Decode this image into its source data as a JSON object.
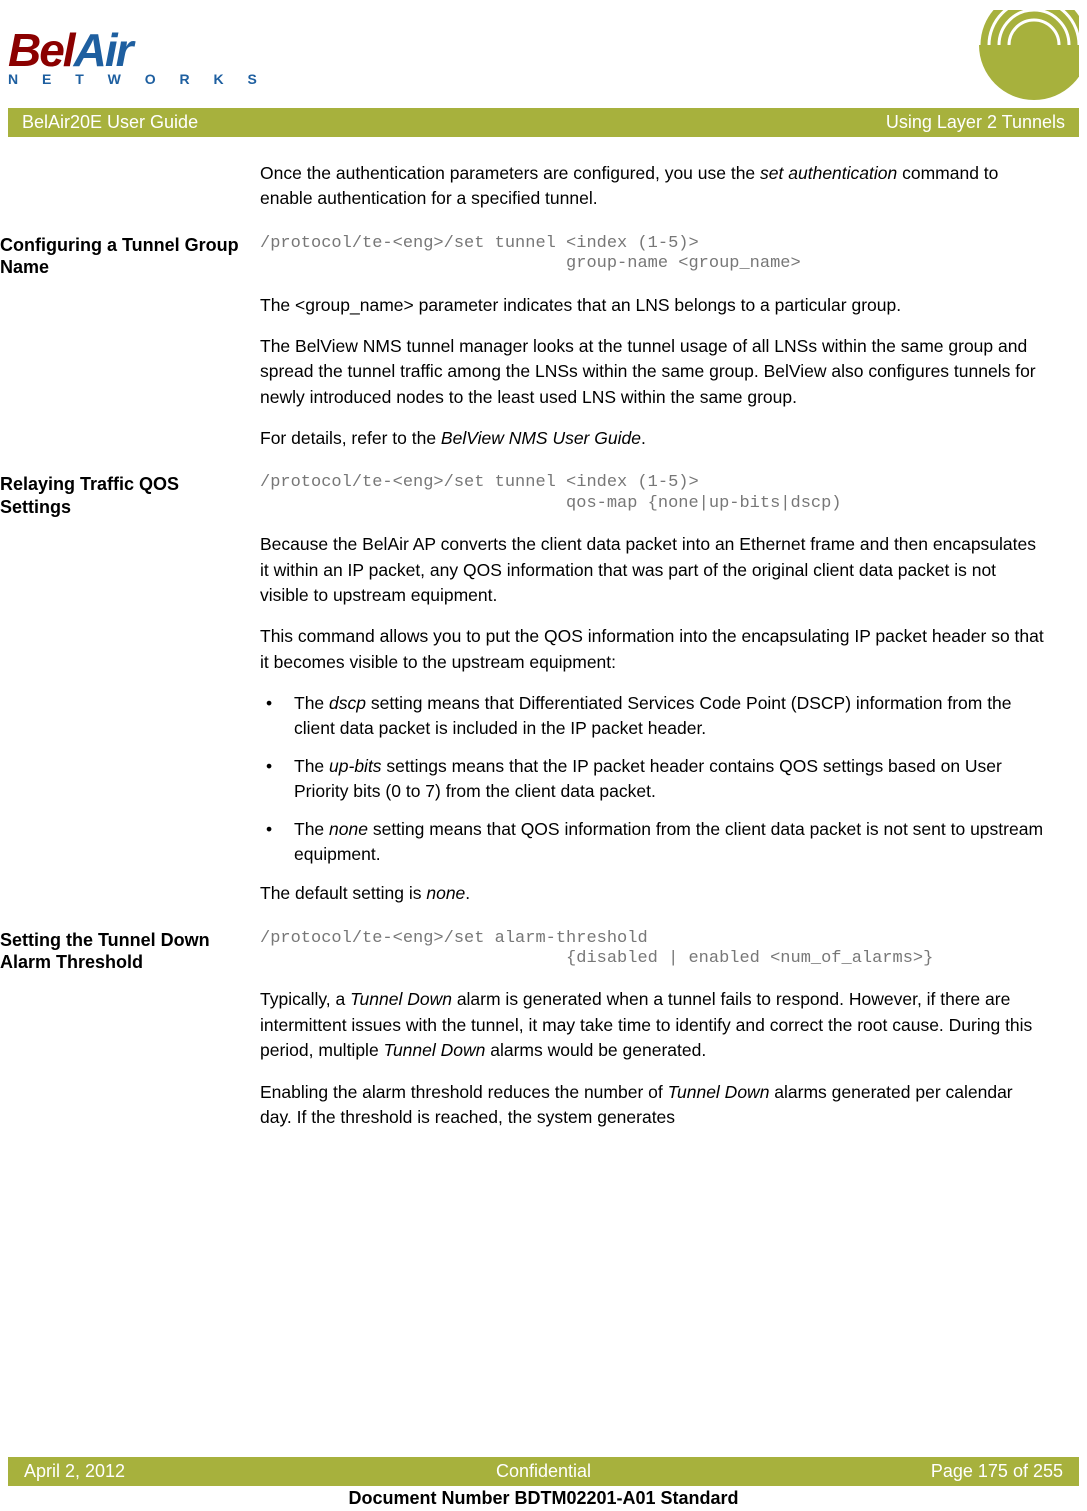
{
  "brand": {
    "name_part1": "Bel",
    "name_part2": "Air",
    "subtitle": "N E T W O R K S"
  },
  "header": {
    "left": "BelAir20E User Guide",
    "right": "Using Layer 2 Tunnels"
  },
  "intro": {
    "text_a": "Once the authentication parameters are configured, you use the ",
    "text_b": "set authentication",
    "text_c": " command to enable authentication for a specified tunnel."
  },
  "section1": {
    "heading": "Configuring a Tunnel Group Name",
    "code": "/protocol/te-<eng>/set tunnel <index (1-5)>\n                              group-name <group_name>",
    "p1": "The <group_name> parameter indicates that an LNS belongs to a particular group.",
    "p2": "The BelView NMS tunnel manager looks at the tunnel usage of all LNSs within the same group and spread the tunnel traffic among the LNSs within the same group. BelView also configures tunnels for newly introduced nodes to the least used LNS within the same group.",
    "p3_a": "For details, refer to the ",
    "p3_b": "BelView NMS User Guide",
    "p3_c": "."
  },
  "section2": {
    "heading": "Relaying Traffic QOS Settings",
    "code": "/protocol/te-<eng>/set tunnel <index (1-5)>\n                              qos-map {none|up-bits|dscp)",
    "p1": "Because the BelAir AP converts the client data packet into an Ethernet frame and then encapsulates it within an IP packet, any QOS information that was part of the original client data packet is not visible to upstream equipment.",
    "p2": "This command allows you to put the QOS information into the encapsulating IP packet header so that it becomes visible to the upstream equipment:",
    "b1_a": "The ",
    "b1_b": "dscp",
    "b1_c": " setting means that Differentiated Services Code Point (DSCP) information from the client data packet is included in the IP packet header.",
    "b2_a": "The ",
    "b2_b": "up-bits",
    "b2_c": " settings means that the IP packet header contains QOS settings based on User Priority bits (0 to 7) from the client data packet.",
    "b3_a": "The ",
    "b3_b": "none",
    "b3_c": " setting means that QOS information from the client data packet is not sent to upstream equipment.",
    "p3_a": "The default setting is ",
    "p3_b": "none",
    "p3_c": "."
  },
  "section3": {
    "heading": "Setting the Tunnel Down Alarm Threshold",
    "code": "/protocol/te-<eng>/set alarm-threshold\n                              {disabled | enabled <num_of_alarms>}",
    "p1_a": "Typically, a ",
    "p1_b": "Tunnel Down",
    "p1_c": " alarm is generated when a tunnel fails to respond. However, if there are intermittent issues with the tunnel, it may take time to identify and correct the root cause. During this period, multiple ",
    "p1_d": "Tunnel Down",
    "p1_e": " alarms would be generated.",
    "p2_a": "Enabling the alarm threshold reduces the number of ",
    "p2_b": "Tunnel Down",
    "p2_c": " alarms generated per calendar day. If the threshold is reached, the system generates"
  },
  "footer": {
    "left": "April 2, 2012",
    "center": "Confidential",
    "right": "Page 175 of 255",
    "docnum": "Document Number BDTM02201-A01 Standard"
  }
}
